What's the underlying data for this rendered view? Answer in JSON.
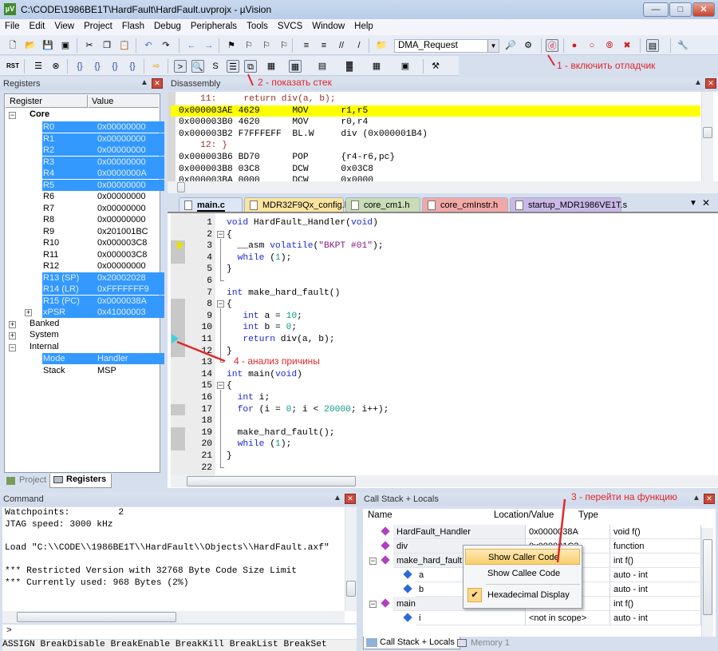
{
  "window": {
    "title": "C:\\CODE\\1986BE1T\\HardFault\\HardFault.uvprojx - µVision",
    "icon": "uvision-logo",
    "controls": [
      "minimize",
      "maximize",
      "close"
    ]
  },
  "menu": [
    "File",
    "Edit",
    "View",
    "Project",
    "Flash",
    "Debug",
    "Peripherals",
    "Tools",
    "SVCS",
    "Window",
    "Help"
  ],
  "toolbar": {
    "target_combo": "DMA_Request",
    "rst_label": "RST",
    "debug_button_icon": "start-debug-session-icon",
    "call_stack_button_icon": "call-stack-window-icon"
  },
  "annotations": {
    "a1": "1 - включить отладчик",
    "a2": "2 - показать стек",
    "a3": "3 - перейти на функцию",
    "a4": "4 - анализ причины",
    "color": "#e2262a"
  },
  "registers": {
    "title": "Registers",
    "columns": [
      "Register",
      "Value"
    ],
    "groups": {
      "core": "Core",
      "banked": "Banked",
      "system": "System",
      "internal": "Internal"
    },
    "core": [
      {
        "name": "R0",
        "value": "0x00000000",
        "sel": true
      },
      {
        "name": "R1",
        "value": "0x00000000",
        "sel": true
      },
      {
        "name": "R2",
        "value": "0x00000000",
        "sel": true
      },
      {
        "name": "R3",
        "value": "0x00000000",
        "sel": true
      },
      {
        "name": "R4",
        "value": "0x0000000A",
        "sel": true
      },
      {
        "name": "R5",
        "value": "0x00000000",
        "sel": true
      },
      {
        "name": "R6",
        "value": "0x00000000",
        "sel": false
      },
      {
        "name": "R7",
        "value": "0x00000000",
        "sel": false
      },
      {
        "name": "R8",
        "value": "0x00000000",
        "sel": false
      },
      {
        "name": "R9",
        "value": "0x201001BC",
        "sel": false
      },
      {
        "name": "R10",
        "value": "0x000003C8",
        "sel": false
      },
      {
        "name": "R11",
        "value": "0x000003C8",
        "sel": false
      },
      {
        "name": "R12",
        "value": "0x00000000",
        "sel": false
      },
      {
        "name": "R13 (SP)",
        "value": "0x20002028",
        "sel": true
      },
      {
        "name": "R14 (LR)",
        "value": "0xFFFFFFF9",
        "sel": true
      },
      {
        "name": "R15 (PC)",
        "value": "0x0000038A",
        "sel": true
      },
      {
        "name": "xPSR",
        "value": "0x41000003",
        "sel": true
      }
    ],
    "internal": [
      {
        "name": "Mode",
        "value": "Handler",
        "sel": true
      },
      {
        "name": "Stack",
        "value": "MSP",
        "sel": false
      }
    ],
    "tabs": [
      "Project",
      "Registers"
    ]
  },
  "disassembly": {
    "title": "Disassembly",
    "rows": [
      {
        "text": "    11:     return div(a, b);",
        "type": "src"
      },
      {
        "text": "0x000003AE 4629      MOV      r1,r5",
        "type": "cur"
      },
      {
        "text": "0x000003B0 4620      MOV      r0,r4",
        "type": "asm"
      },
      {
        "text": "0x000003B2 F7FFFEFF  BL.W     div (0x000001B4)",
        "type": "asm"
      },
      {
        "text": "    12: }",
        "type": "src"
      },
      {
        "text": "0x000003B6 BD70      POP      {r4-r6,pc}",
        "type": "asm"
      },
      {
        "text": "0x000003B8 03C8      DCW      0x03C8",
        "type": "asm"
      },
      {
        "text": "0x000003BA 0000      DCW      0x0000",
        "type": "asm"
      }
    ]
  },
  "editor": {
    "tabs": [
      {
        "label": "main.c",
        "color": "#dce6f6",
        "active": true
      },
      {
        "label": "MDR32F9Qx_config.h",
        "color": "#fbe4a0"
      },
      {
        "label": "core_cm1.h",
        "color": "#c9dcb6"
      },
      {
        "label": "core_cmInstr.h",
        "color": "#f2a8a8"
      },
      {
        "label": "startup_MDR1986VE1T.s",
        "color": "#c9b9e6"
      }
    ],
    "lines": [
      [
        [
          "void",
          "kw"
        ],
        [
          " HardFault_Handler(",
          "pl"
        ],
        [
          "void",
          "kw"
        ],
        [
          ")",
          "pl"
        ]
      ],
      [
        [
          "{",
          "pl"
        ]
      ],
      [
        [
          "  __asm ",
          "pl"
        ],
        [
          "volatile",
          "kw"
        ],
        [
          "(",
          "pl"
        ],
        [
          "\"BKPT #01\"",
          "str"
        ],
        [
          ");",
          "pl"
        ]
      ],
      [
        [
          "  ",
          "pl"
        ],
        [
          "while",
          "kw"
        ],
        [
          " (",
          "pl"
        ],
        [
          "1",
          "num"
        ],
        [
          ");",
          "pl"
        ]
      ],
      [
        [
          "}",
          "pl"
        ]
      ],
      [],
      [
        [
          "int",
          "kw"
        ],
        [
          " make_hard_fault()",
          "pl"
        ]
      ],
      [
        [
          "{",
          "pl"
        ]
      ],
      [
        [
          "   ",
          "pl"
        ],
        [
          "int",
          "kw"
        ],
        [
          " a = ",
          "pl"
        ],
        [
          "10",
          "num"
        ],
        [
          ";",
          "pl"
        ]
      ],
      [
        [
          "   ",
          "pl"
        ],
        [
          "int",
          "kw"
        ],
        [
          " b = ",
          "pl"
        ],
        [
          "0",
          "num"
        ],
        [
          ";",
          "pl"
        ]
      ],
      [
        [
          "   ",
          "pl"
        ],
        [
          "return",
          "kw"
        ],
        [
          " div(a, b);",
          "pl"
        ]
      ],
      [
        [
          "}",
          "pl"
        ]
      ],
      [],
      [
        [
          "int",
          "kw"
        ],
        [
          " main(",
          "pl"
        ],
        [
          "void",
          "kw"
        ],
        [
          ")",
          "pl"
        ]
      ],
      [
        [
          "{",
          "pl"
        ]
      ],
      [
        [
          "  ",
          "pl"
        ],
        [
          "int",
          "kw"
        ],
        [
          " i;",
          "pl"
        ]
      ],
      [
        [
          "  ",
          "pl"
        ],
        [
          "for",
          "kw"
        ],
        [
          " (i = ",
          "pl"
        ],
        [
          "0",
          "num"
        ],
        [
          "; i < ",
          "pl"
        ],
        [
          "20000",
          "num"
        ],
        [
          "; i++);",
          "pl"
        ]
      ],
      [],
      [
        [
          "  make_hard_fault();",
          "pl"
        ]
      ],
      [
        [
          "  ",
          "pl"
        ],
        [
          "while",
          "kw"
        ],
        [
          " (",
          "pl"
        ],
        [
          "1",
          "num"
        ],
        [
          ");",
          "pl"
        ]
      ],
      [
        [
          "}",
          "pl"
        ]
      ],
      []
    ]
  },
  "command": {
    "title": "Command",
    "lines": [
      "Watchpoints:         2",
      "JTAG speed: 3000 kHz",
      "",
      "Load \"C:\\\\CODE\\\\1986BE1T\\\\HardFault\\\\Objects\\\\HardFault.axf\"",
      "",
      "*** Restricted Version with 32768 Byte Code Size Limit",
      "*** Currently used: 968 Bytes (2%)"
    ],
    "prompt": ">",
    "hint": "ASSIGN BreakDisable BreakEnable BreakKill BreakList BreakSet"
  },
  "callstack": {
    "title": "Call Stack + Locals",
    "columns": [
      "Name",
      "Location/Value",
      "Type"
    ],
    "rows": [
      {
        "name": "HardFault_Handler",
        "loc": "0x0000038A",
        "type": "void f()",
        "lvl": 0,
        "kind": "func"
      },
      {
        "name": "div",
        "loc": "0x000001C2",
        "type": "function",
        "lvl": 0,
        "kind": "func"
      },
      {
        "name": "make_hard_fault",
        "loc": "0x00000000",
        "type": "int f()",
        "lvl": 0,
        "kind": "func",
        "exp": true
      },
      {
        "name": "a",
        "loc": "0x0000000A",
        "type": "auto - int",
        "lvl": 1,
        "kind": "var"
      },
      {
        "name": "b",
        "loc": "0x00000000",
        "type": "auto - int",
        "lvl": 1,
        "kind": "var"
      },
      {
        "name": "main",
        "loc": "0x00000000",
        "type": "int f()",
        "lvl": 0,
        "kind": "func",
        "exp": true
      },
      {
        "name": "i",
        "loc": "<not in scope>",
        "type": "auto - int",
        "lvl": 1,
        "kind": "var"
      }
    ],
    "context_menu": [
      {
        "label": "Show Caller Code",
        "hover": true
      },
      {
        "label": "Show Callee Code"
      },
      {
        "label": "Hexadecimal Display",
        "checked": true
      }
    ],
    "tabs": [
      "Call Stack + Locals",
      "Memory 1"
    ]
  }
}
